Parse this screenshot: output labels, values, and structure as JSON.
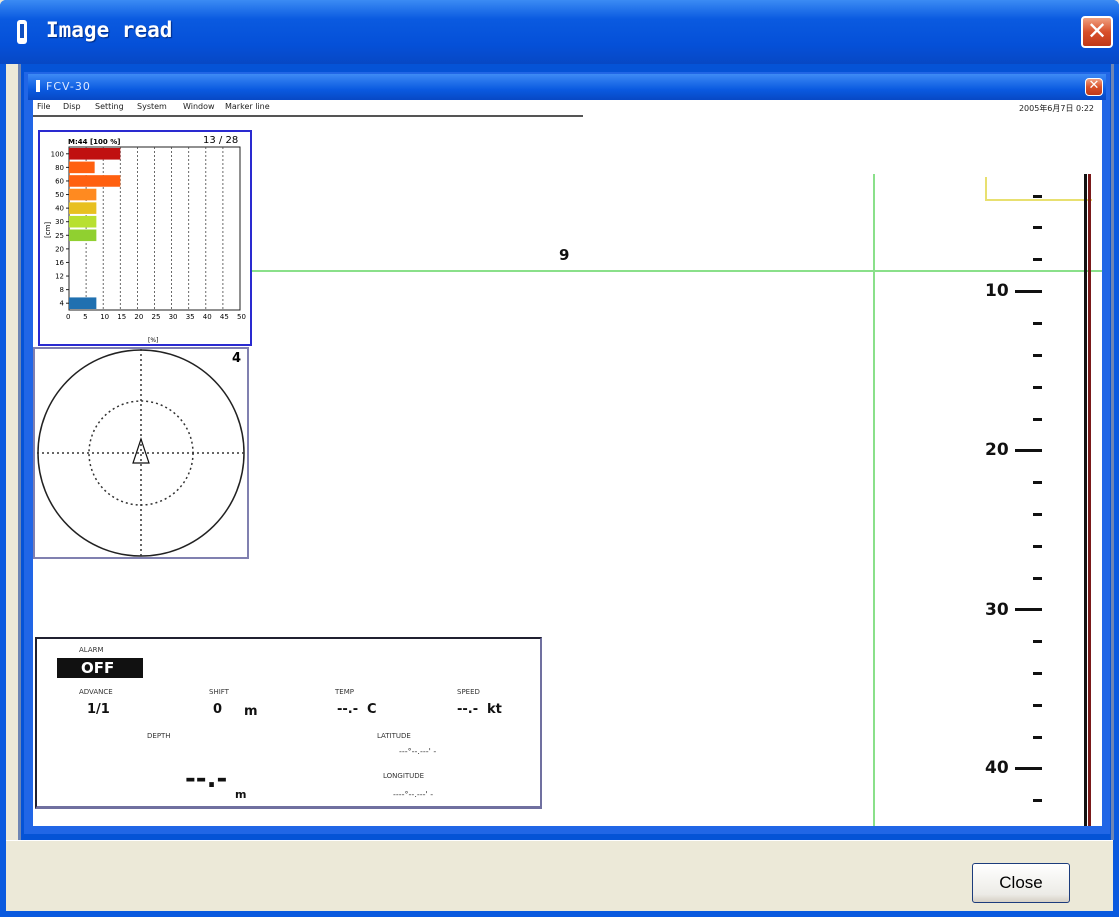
{
  "outer_window": {
    "title": "Image read",
    "close_label": "✕"
  },
  "inner_window": {
    "title": "FCV-30",
    "close_label": "✕"
  },
  "menu": [
    "File",
    "Disp",
    "Setting",
    "System",
    "Window",
    "Marker line"
  ],
  "datetime": "2005年6月7日 0:22",
  "marker_label": "9",
  "depth_scale": {
    "labels": [
      "10",
      "20",
      "30",
      "40"
    ]
  },
  "histogram": {
    "header_left": "M:44 [100 %]",
    "header_right": "13 / 28",
    "ylabel": "[cm]",
    "xlabel": "[%]"
  },
  "chart_data": {
    "type": "bar",
    "orientation": "horizontal",
    "title": "M:44 [100 %]",
    "ylabel": "[cm]",
    "xlabel": "[%]",
    "categories": [
      "100",
      "80",
      "60",
      "50",
      "40",
      "30",
      "25",
      "20",
      "16",
      "12",
      "8",
      "4"
    ],
    "x_ticks": [
      0,
      5,
      10,
      15,
      20,
      25,
      30,
      35,
      40,
      45,
      50
    ],
    "xlim": [
      0,
      50
    ],
    "bars": [
      {
        "category": "100",
        "value": 15,
        "color": "#c01010"
      },
      {
        "category": "80",
        "value": 7.5,
        "color": "#ff6010"
      },
      {
        "category": "60",
        "value": 15,
        "color": "#ff6010"
      },
      {
        "category": "50",
        "value": 8,
        "color": "#ff8a20"
      },
      {
        "category": "40",
        "value": 8,
        "color": "#e8c020"
      },
      {
        "category": "30",
        "value": 8,
        "color": "#b8e030"
      },
      {
        "category": "25",
        "value": 8,
        "color": "#90d030"
      },
      {
        "category": "4",
        "value": 8,
        "color": "#2070b0"
      }
    ],
    "grid": true
  },
  "compass": {
    "number": "4"
  },
  "info": {
    "alarm_label": "ALARM",
    "alarm_value": "OFF",
    "advance_label": "ADVANCE",
    "advance_value": "1/1",
    "shift_label": "SHIFT",
    "shift_value": "0",
    "shift_unit": "m",
    "temp_label": "TEMP",
    "temp_value": "--.-",
    "temp_unit": "C",
    "speed_label": "SPEED",
    "speed_value": "--.-",
    "speed_unit": "kt",
    "depth_label": "DEPTH",
    "depth_value": "--.-",
    "depth_unit": "m",
    "latitude_label": "LATITUDE",
    "latitude_value": "---°--.---' -",
    "longitude_label": "LONGITUDE",
    "longitude_value": "----°--.---' -"
  },
  "footer": {
    "close_label": "Close"
  }
}
